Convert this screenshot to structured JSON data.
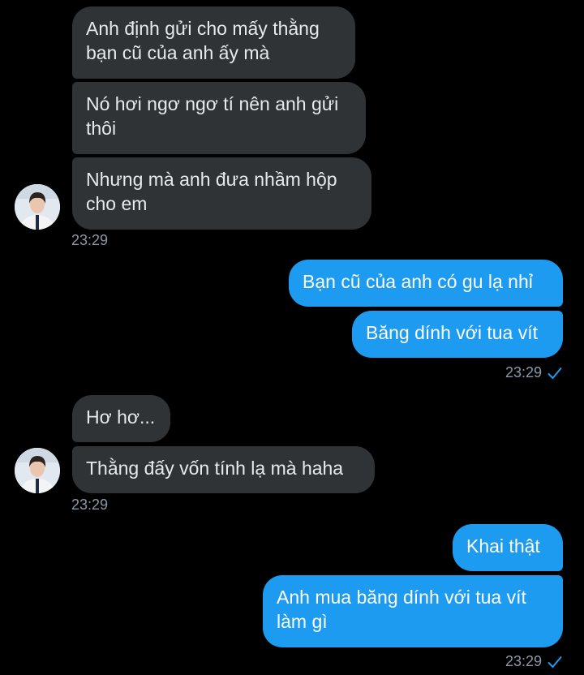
{
  "colors": {
    "background": "#000000",
    "incoming_bubble": "#2f3336",
    "outgoing_bubble": "#1d9bf0",
    "timestamp": "#8b98a5",
    "read_check": "#1d9bf0"
  },
  "messages": [
    {
      "direction": "incoming",
      "text": "Anh định gửi cho mấy thằng bạn cũ của anh ấy mà"
    },
    {
      "direction": "incoming",
      "text": "Nó hơi ngơ ngơ tí nên anh gửi thôi"
    },
    {
      "direction": "incoming",
      "text": "Nhưng mà anh đưa nhầm hộp cho em"
    },
    {
      "direction": "outgoing",
      "text": "Bạn cũ của anh có gu lạ nhỉ"
    },
    {
      "direction": "outgoing",
      "text": "Băng dính với tua vít"
    },
    {
      "direction": "incoming",
      "text": "Hơ hơ..."
    },
    {
      "direction": "incoming",
      "text": "Thằng đấy vốn tính lạ mà haha"
    },
    {
      "direction": "outgoing",
      "text": "Khai thật"
    },
    {
      "direction": "outgoing",
      "text": "Anh mua băng dính với tua vít làm gì"
    }
  ],
  "timestamps": {
    "group1": "23:29",
    "group2": "23:29",
    "group3": "23:29",
    "group4": "23:29"
  },
  "icons": {
    "avatar": "avatar-icon",
    "read_receipt": "checkmark-icon"
  }
}
